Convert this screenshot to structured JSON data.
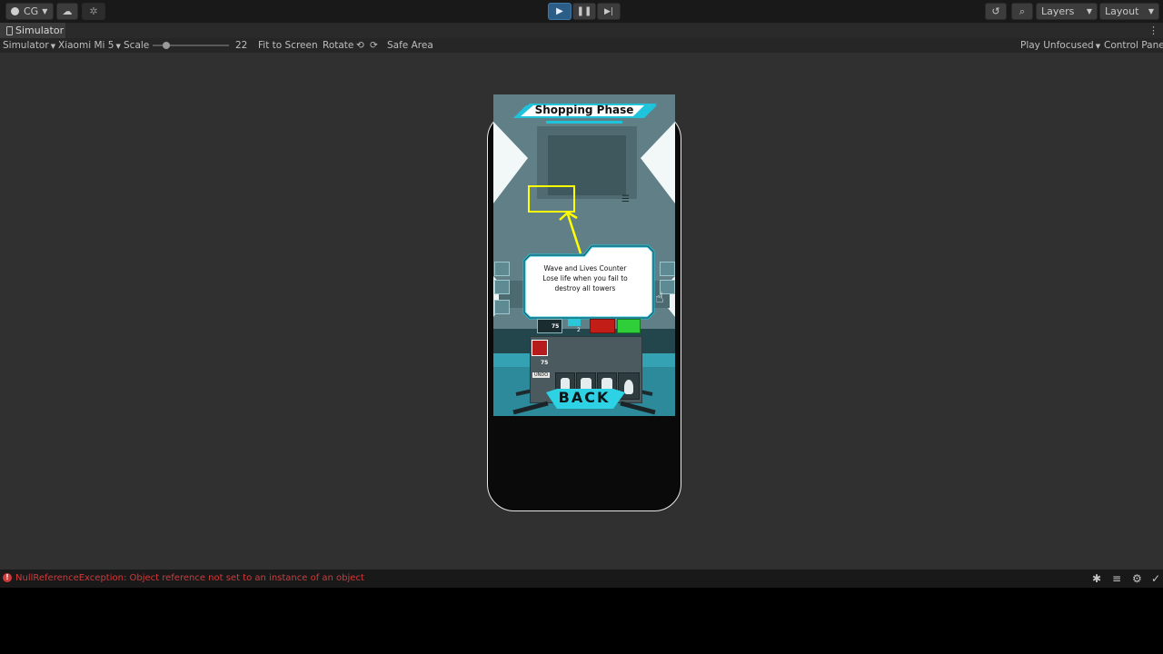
{
  "topbar": {
    "account_label": "CG",
    "layers_label": "Layers",
    "layout_label": "Layout",
    "icons": [
      "account-icon",
      "cloud-icon",
      "collab-icon",
      "play-icon",
      "pause-icon",
      "step-icon",
      "history-icon",
      "search-icon"
    ]
  },
  "tab": {
    "title": "Simulator"
  },
  "toolbar": {
    "mode": "Simulator",
    "device": "Xiaomi Mi 5",
    "scale_label": "Scale",
    "scale_value": "22",
    "fit_label": "Fit to Screen",
    "rotate_label": "Rotate",
    "safe_area_label": "Safe Area",
    "play_mode": "Play Unfocused",
    "control_panel": "Control Panel"
  },
  "game": {
    "title": "Shopping Phase",
    "tooltip_line1": "Wave and Lives Counter",
    "tooltip_line2": "Lose life when you fail to",
    "tooltip_line3": "destroy all towers",
    "back_label": "BACK",
    "money_value": "75",
    "count_value": "2",
    "stat_value": "75",
    "unit_tag": "UNDO"
  },
  "status": {
    "error_message": "NullReferenceException: Object reference not set to an instance of an object"
  },
  "colors": {
    "play_active": "#2c5d87",
    "highlight": "#ffff00",
    "error": "#d03a3a",
    "accent": "#22c3d8"
  }
}
